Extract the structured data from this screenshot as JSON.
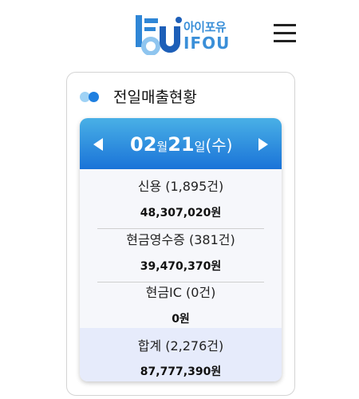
{
  "header": {
    "logo_ko": "아이포유",
    "logo_en": "IFOU"
  },
  "card": {
    "title": "전일매출현황",
    "date": {
      "month": "02",
      "month_unit": "월",
      "day": "21",
      "day_unit": "일",
      "weekday": "(수)"
    },
    "rows": [
      {
        "label": "신용 (1,895건)",
        "amount": "48,307,020원"
      },
      {
        "label": "현금영수증 (381건)",
        "amount": "39,470,370원"
      },
      {
        "label": "현금IC (0건)",
        "amount": "0원"
      }
    ],
    "total": {
      "label": "합계 (2,276건)",
      "amount": "87,777,390원"
    }
  },
  "colors": {
    "accent": "#1a73d8",
    "accent_light": "#49b0e6",
    "total_bg": "#e6ebfb"
  }
}
